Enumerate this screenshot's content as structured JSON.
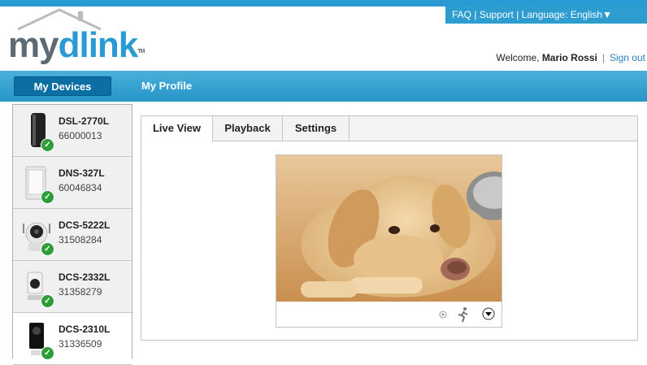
{
  "header": {
    "links": {
      "faq": "FAQ",
      "sep1": "|",
      "support": "Support",
      "sep2": "|",
      "language": "Language: English",
      "language_arrow": "▼"
    },
    "logo": {
      "my": "my",
      "dlink": "dlink",
      "tm": "TM"
    },
    "welcome": {
      "prefix": "Welcome,",
      "user": "Mario Rossi",
      "sep": "|",
      "signout": "Sign out"
    }
  },
  "nav": {
    "tabs": [
      {
        "label": "My Devices",
        "active": true
      },
      {
        "label": "My Profile",
        "active": false
      }
    ]
  },
  "devices": [
    {
      "name": "DSL-2770L",
      "serial": "66000013",
      "status": "online",
      "icon": "router-icon"
    },
    {
      "name": "DNS-327L",
      "serial": "60046834",
      "status": "online",
      "icon": "nas-icon"
    },
    {
      "name": "DCS-5222L",
      "serial": "31508284",
      "status": "online",
      "icon": "ptz-camera-icon"
    },
    {
      "name": "DCS-2332L",
      "serial": "31358279",
      "status": "online",
      "icon": "outdoor-camera-icon"
    },
    {
      "name": "DCS-2310L",
      "serial": "31336509",
      "status": "online",
      "icon": "camera-icon"
    }
  ],
  "panel": {
    "tabs": [
      {
        "label": "Live View",
        "active": true
      },
      {
        "label": "Playback"
      },
      {
        "label": "Settings"
      }
    ],
    "viewer": {
      "image": "dog-photo",
      "controls": [
        "record-dot-icon",
        "motion-runner-icon",
        "dropdown-arrow-icon"
      ]
    }
  },
  "colors": {
    "accent": "#2a9bd2",
    "nav_active": "#0c6fa4",
    "status_ok": "#2e9e3a"
  }
}
